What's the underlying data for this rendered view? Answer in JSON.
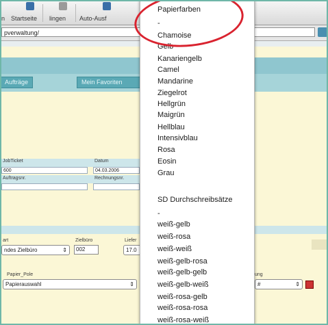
{
  "toolbar": {
    "buttons": [
      {
        "label": "n",
        "icon": "back-icon"
      },
      {
        "label": "Startseite",
        "icon": "home-icon"
      },
      {
        "label": "lingen",
        "icon": "settings-icon"
      },
      {
        "label": "Auto-Ausf",
        "icon": "autofill-icon"
      }
    ]
  },
  "address_bar": {
    "value": "pverwaltung/"
  },
  "nav_tabs": [
    "Aufträge",
    "Mein Favoriten"
  ],
  "form": {
    "row1_labels": [
      "JobTicket",
      "Datum"
    ],
    "row1_values": [
      "600",
      "04.03.2006"
    ],
    "row2_labels": [
      "Auftragsnr.",
      "Rechnungsnr."
    ],
    "art_label": "art",
    "zielburo_label": "Zielbüro",
    "liefer_label": "Liefer",
    "select_zielburo": "ndes Zielbüro",
    "zielburo_input": "002",
    "liefer_input": "17.0",
    "paper_label": "Papier_Pole",
    "paper_select": "Papierauswahl",
    "right_label": "ung",
    "right_select": "#"
  },
  "menu": {
    "items": [
      "Papierfarben",
      "-",
      "Chamoise",
      "Gelb",
      "Kanariengelb",
      "Camel",
      "Mandarine",
      "Ziegelrot",
      "Hellgrün",
      "Maigrün",
      "Hellblau",
      "Intensivblau",
      "Rosa",
      "Eosin",
      "Grau",
      "",
      "SD Durchschreibsätze",
      "-",
      "weiß-gelb",
      "weiß-rosa",
      "weiß-weiß",
      "weiß-gelb-rosa",
      "weiß-gelb-gelb",
      "weiß-gelb-weiß",
      "weiß-rosa-gelb",
      "weiß-rosa-rosa",
      "weiß-rosa-weiß"
    ]
  },
  "colors": {
    "highlight_circle": "#d9232f",
    "teal_header": "#8fc6cf",
    "page_background": "#fbf7d6"
  }
}
